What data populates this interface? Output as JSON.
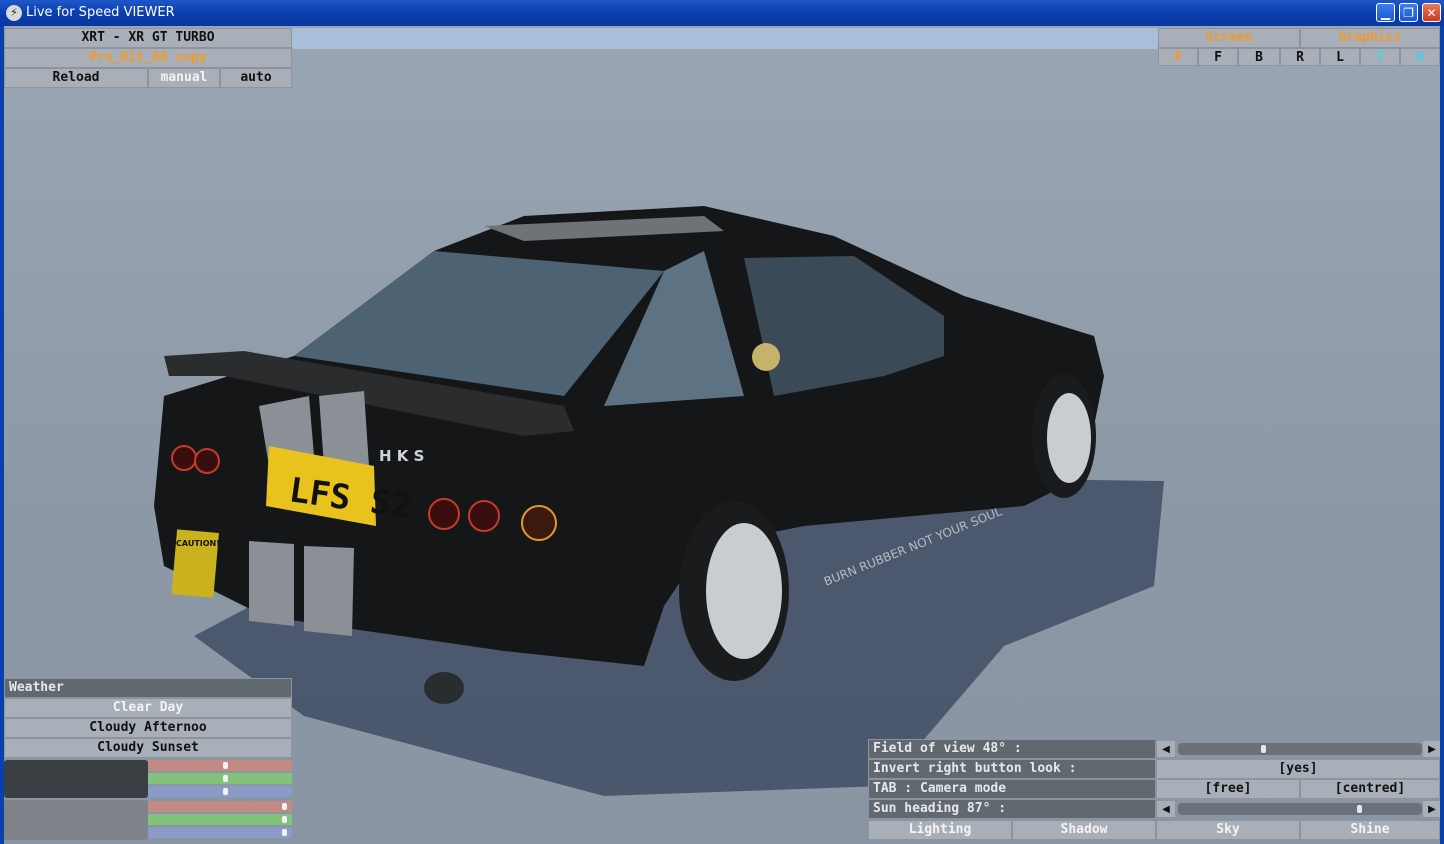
{
  "window": {
    "title": "Live for Speed VIEWER",
    "app_icon": "lfs-logo-icon"
  },
  "car_panel": {
    "car_name": "XRT - XR GT TURBO",
    "skin_name": "Pro_Kit_08 copy",
    "reload_label": "Reload",
    "manual_label": "manual",
    "auto_label": "auto"
  },
  "view_panel": {
    "screen_label": "Screen",
    "graphics_label": "Graphics",
    "buttons": [
      "P",
      "F",
      "B",
      "R",
      "L",
      "T",
      "U"
    ]
  },
  "car_scene": {
    "plate_text": "LFS S2",
    "side_decal": "BURN RUBBER NOT YOUR SOUL",
    "rear_badge": "H K S",
    "caution_sticker": "CAUTION!"
  },
  "weather": {
    "header": "Weather",
    "options": [
      "Clear Day",
      "Cloudy Afternoo",
      "Cloudy Sunset"
    ],
    "sky_sliders": [
      0.54,
      0.54,
      0.54
    ],
    "ambient_sliders": [
      0.97,
      0.97,
      0.97
    ]
  },
  "settings": {
    "fov_label": "Field of view 48° :",
    "fov_value": 0.35,
    "invert_label": "Invert right button look :",
    "invert_value": "[yes]",
    "tab_label": "TAB : Camera mode",
    "camera_free": "[free]",
    "camera_centred": "[centred]",
    "sun_label": "Sun heading 87° :",
    "sun_value": 0.75,
    "tabs": [
      "Lighting",
      "Shadow",
      "Sky",
      "Shine"
    ]
  },
  "colors": {
    "panel": "#a9afb8",
    "panel_dark": "#606870",
    "accent_orange": "#f29a2a",
    "accent_cyan": "#3ad7e6",
    "titlebar": "#0a3fae"
  }
}
